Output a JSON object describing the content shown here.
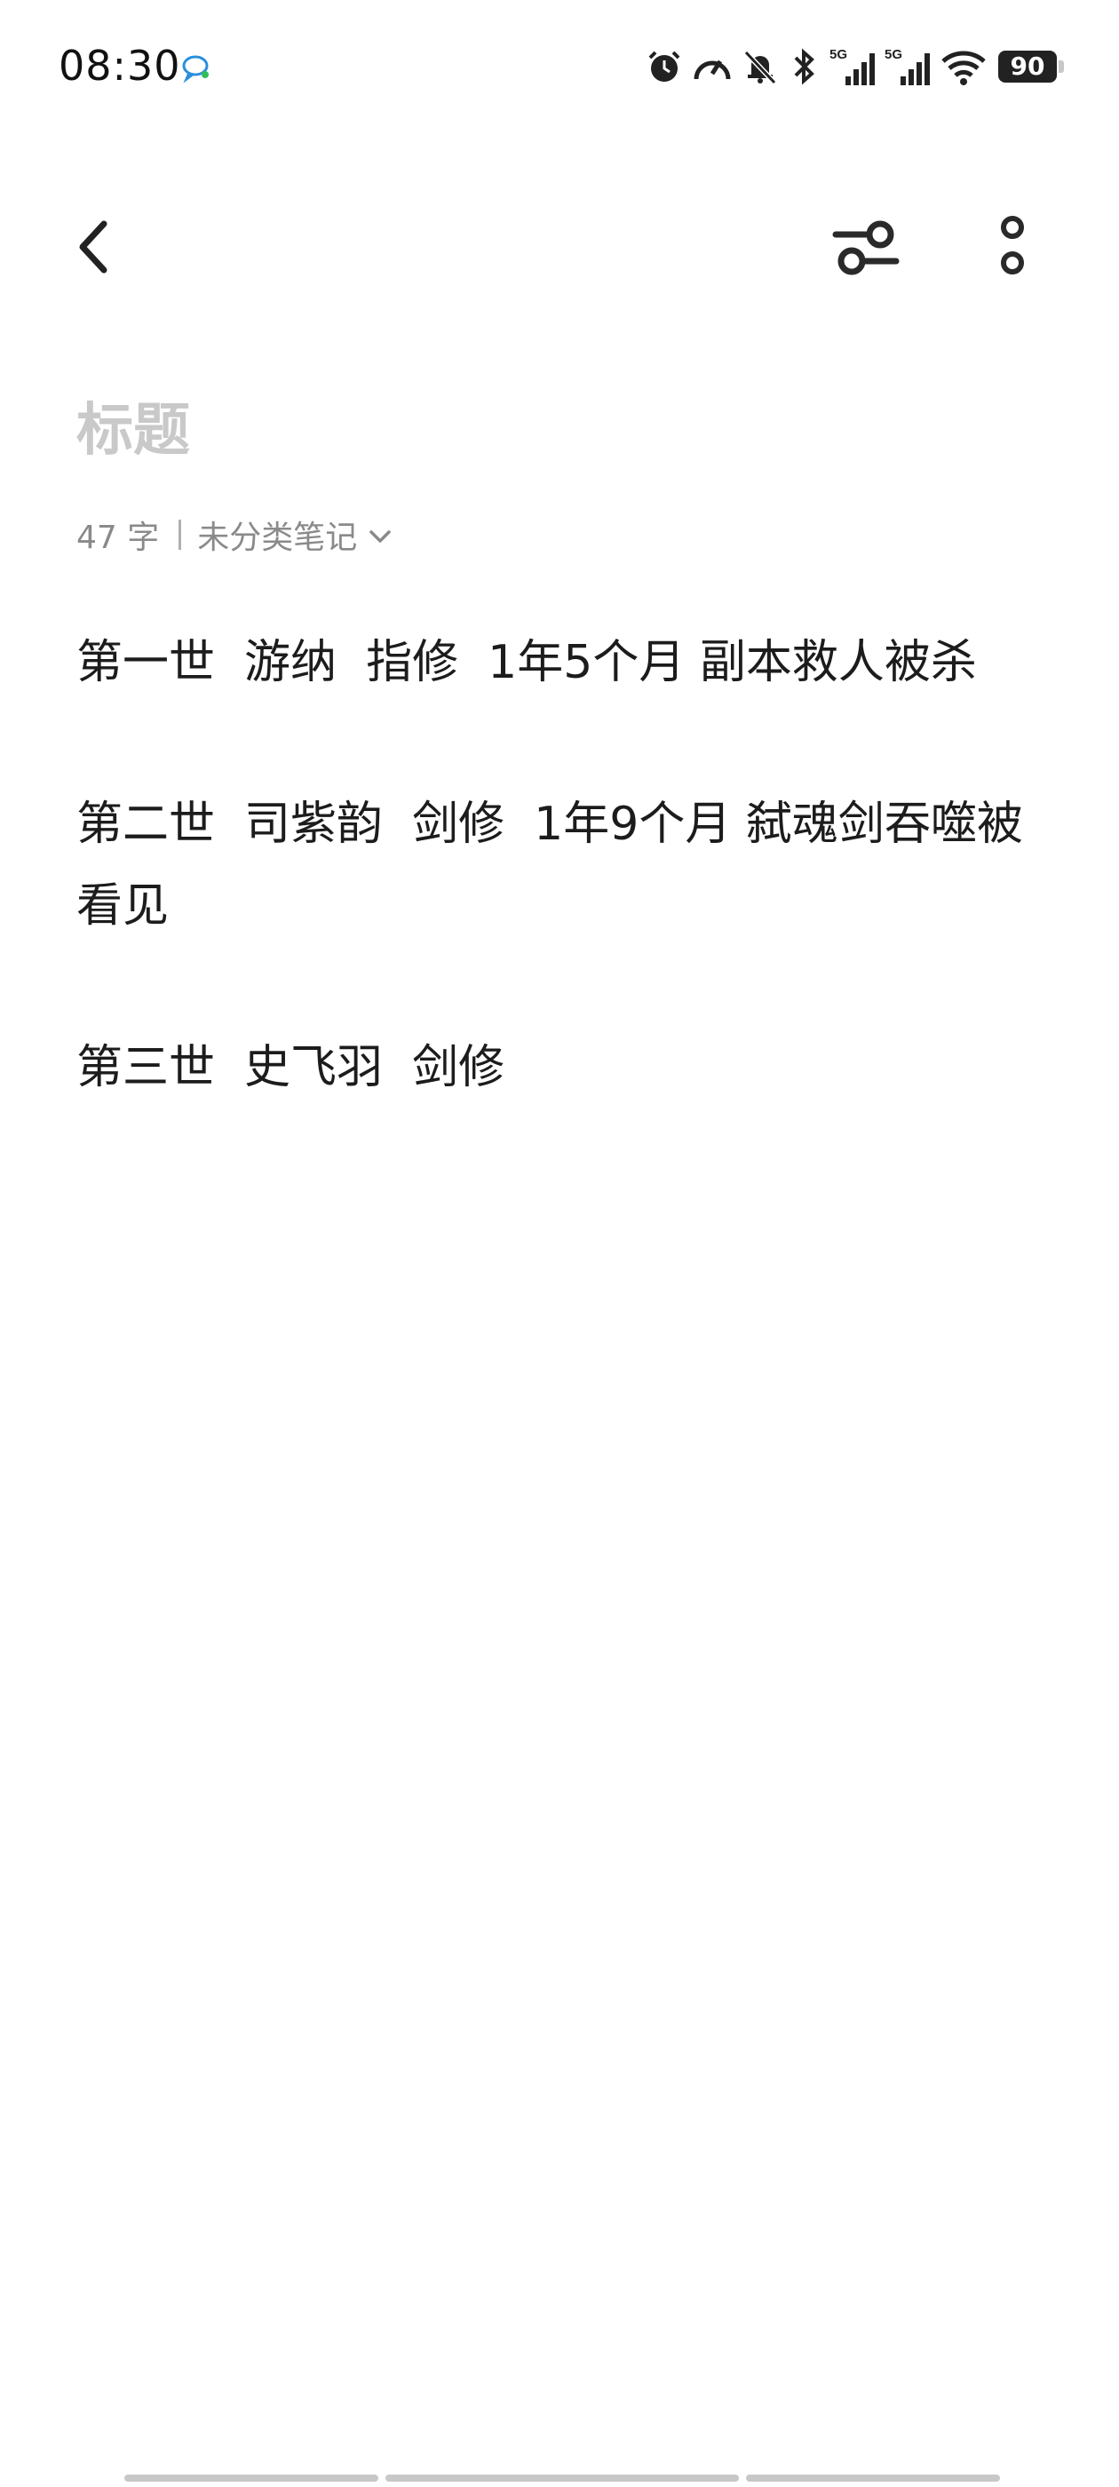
{
  "status_bar": {
    "time": "08:30",
    "icons": [
      "chat-bubble-icon",
      "alarm-icon",
      "speedometer-icon",
      "bell-muted-icon",
      "bluetooth-icon",
      "signal-5g-icon",
      "signal-5g-icon",
      "wifi-icon",
      "battery-icon"
    ],
    "signal_1_label": "5G",
    "signal_2_label": "5G",
    "battery_level": "90"
  },
  "toolbar": {
    "back_icon": "chevron-left-icon",
    "filter_icon": "sliders-icon",
    "more_icon": "more-vertical-icon"
  },
  "note": {
    "title_placeholder": "标题",
    "word_count": "47 字",
    "category": "未分类笔记",
    "paragraphs": [
      "第一世  游纳  指修  1年5个月 副本救人被杀",
      "第二世  司紫韵  剑修  1年9个月 弑魂剑吞噬被看见",
      "第三世  史飞羽  剑修"
    ]
  },
  "colors": {
    "text": "#1c1c1c",
    "placeholder": "#c9c9c9",
    "meta": "#8a8a8a",
    "background": "#ffffff"
  }
}
